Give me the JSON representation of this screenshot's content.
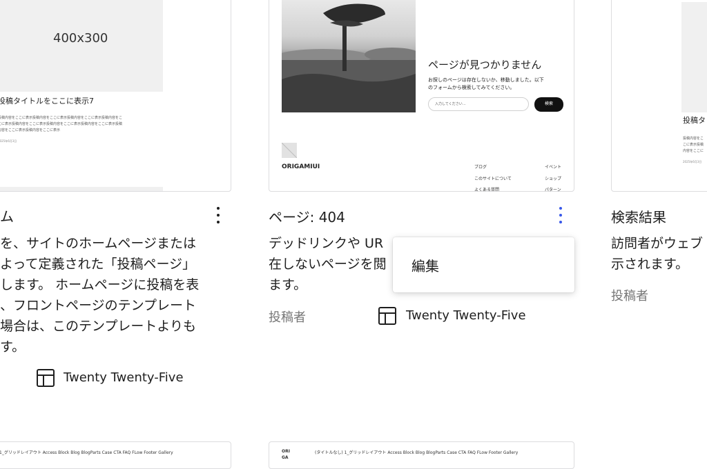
{
  "cards": [
    {
      "preview": {
        "placeholder": "400x300",
        "post_title": "投稿タイトルをここに表示7",
        "excerpt_lines": [
          "投稿内容をここに表示投稿内容をここに表示投稿内容をここに表示投稿内容をこ",
          "こに表示投稿内容をここに表示投稿内容をここに表示投稿内容をここに表示投稿",
          "内容をここに表示投稿内容をここに表示"
        ],
        "date": "2025年6月3日"
      },
      "title": "ム",
      "description_lines": [
        "を、サイトのホームページまたは",
        "よって定義された「投稿ページ」",
        "します。 ホームページに投稿を表",
        "、フロントページのテンプレート",
        "場合は、このテンプレートよりも",
        "す。"
      ],
      "theme": "Twenty Twenty-Five"
    },
    {
      "preview": {
        "heading": "ページが見つかりません",
        "body_lines": [
          "お探しのページは存在しないか、移動しました。以下",
          "のフォームから検索してみてください。"
        ],
        "search_placeholder": "入力してください…",
        "search_button": "検索",
        "logo_text": "ORIGAMIUI",
        "footer_links_left": [
          "ブログ",
          "このサイトについて",
          "よくある質問"
        ],
        "footer_links_right": [
          "イベント",
          "ショップ",
          "パターン"
        ]
      },
      "title": "ページ: 404",
      "description_lines": [
        "デッドリンクや UR",
        "在しないページを閲",
        "ます。"
      ],
      "author": "投稿者",
      "theme": "Twenty Twenty-Five",
      "menu": {
        "items": [
          "編集"
        ]
      }
    },
    {
      "preview": {
        "post_title": "投稿タ",
        "excerpt_lines": [
          "投稿内容をこ",
          "こに表示投稿",
          "内容をここに"
        ],
        "date": "2025年6月3日"
      },
      "title": "検索結果",
      "description_lines": [
        "訪問者がウェブ",
        "示されます。"
      ],
      "author": "投稿者"
    }
  ],
  "bottom_previews": {
    "left_nav": "1_グリッドレイアウト   Access   Block   Blog   BlogParts   Case   CTA   FAQ   FLow   Footer   Gallery",
    "middle_logo_lines": [
      "ORI",
      "GA"
    ],
    "middle_nav": "(タイトルなし)   1_グリッドレイアウト   Access   Block   Blog   BlogParts   Case   CTA   FAQ   FLow   Footer   Gallery"
  },
  "icons": {
    "layout_icon": "layout-template-icon",
    "more_icon": "more-vertical-icon"
  },
  "colors": {
    "accent": "#3858e9",
    "text": "#1e1e1e",
    "muted": "#757575"
  }
}
